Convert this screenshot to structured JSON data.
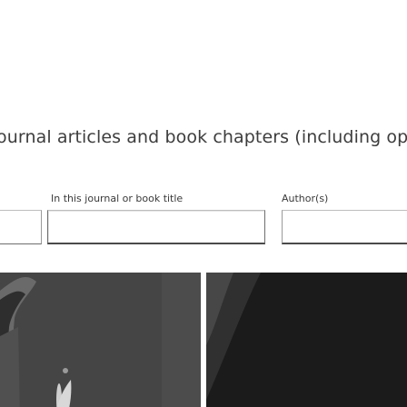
{
  "headline": "ournal articles and book chapters (including open ac",
  "search": {
    "title_label": "In this journal or book title",
    "author_label": "Author(s)",
    "title_value": "",
    "author_value": ""
  }
}
